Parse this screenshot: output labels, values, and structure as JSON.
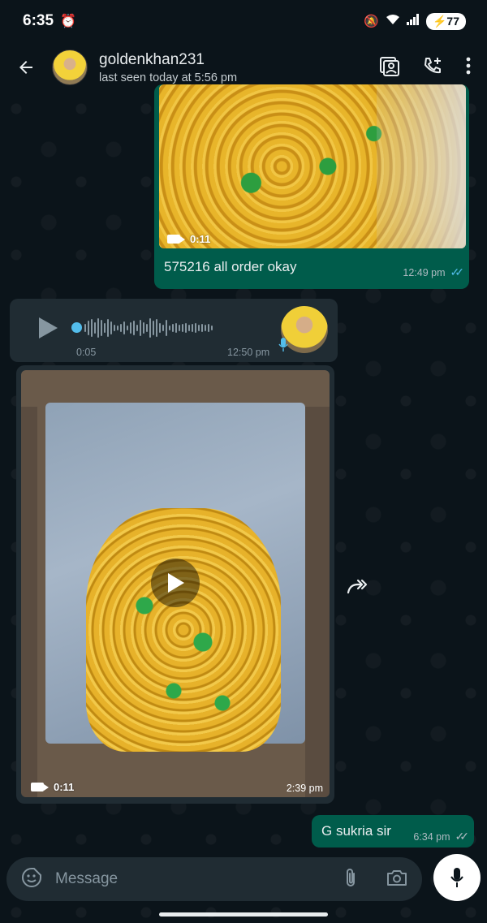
{
  "status_bar": {
    "time": "6:35",
    "battery": "77"
  },
  "header": {
    "contact_name": "goldenkhan231",
    "last_seen": "last seen today at 5:56 pm"
  },
  "messages": [
    {
      "type": "video",
      "direction": "outgoing",
      "duration": "0:11",
      "caption": "575216 all order okay",
      "time": "12:49 pm",
      "read": true
    },
    {
      "type": "voice",
      "direction": "incoming",
      "elapsed": "0:05",
      "time": "12:50 pm"
    },
    {
      "type": "video",
      "direction": "incoming",
      "duration": "0:11",
      "time": "2:39 pm"
    },
    {
      "type": "text",
      "direction": "outgoing",
      "text": "G sukria sir",
      "time": "6:34 pm",
      "read": true
    }
  ],
  "composer": {
    "placeholder": "Message"
  },
  "colors": {
    "background": "#0b141a",
    "outgoing_bubble": "#005c4b",
    "incoming_bubble": "#202c33",
    "read_ticks": "#53bdeb"
  }
}
